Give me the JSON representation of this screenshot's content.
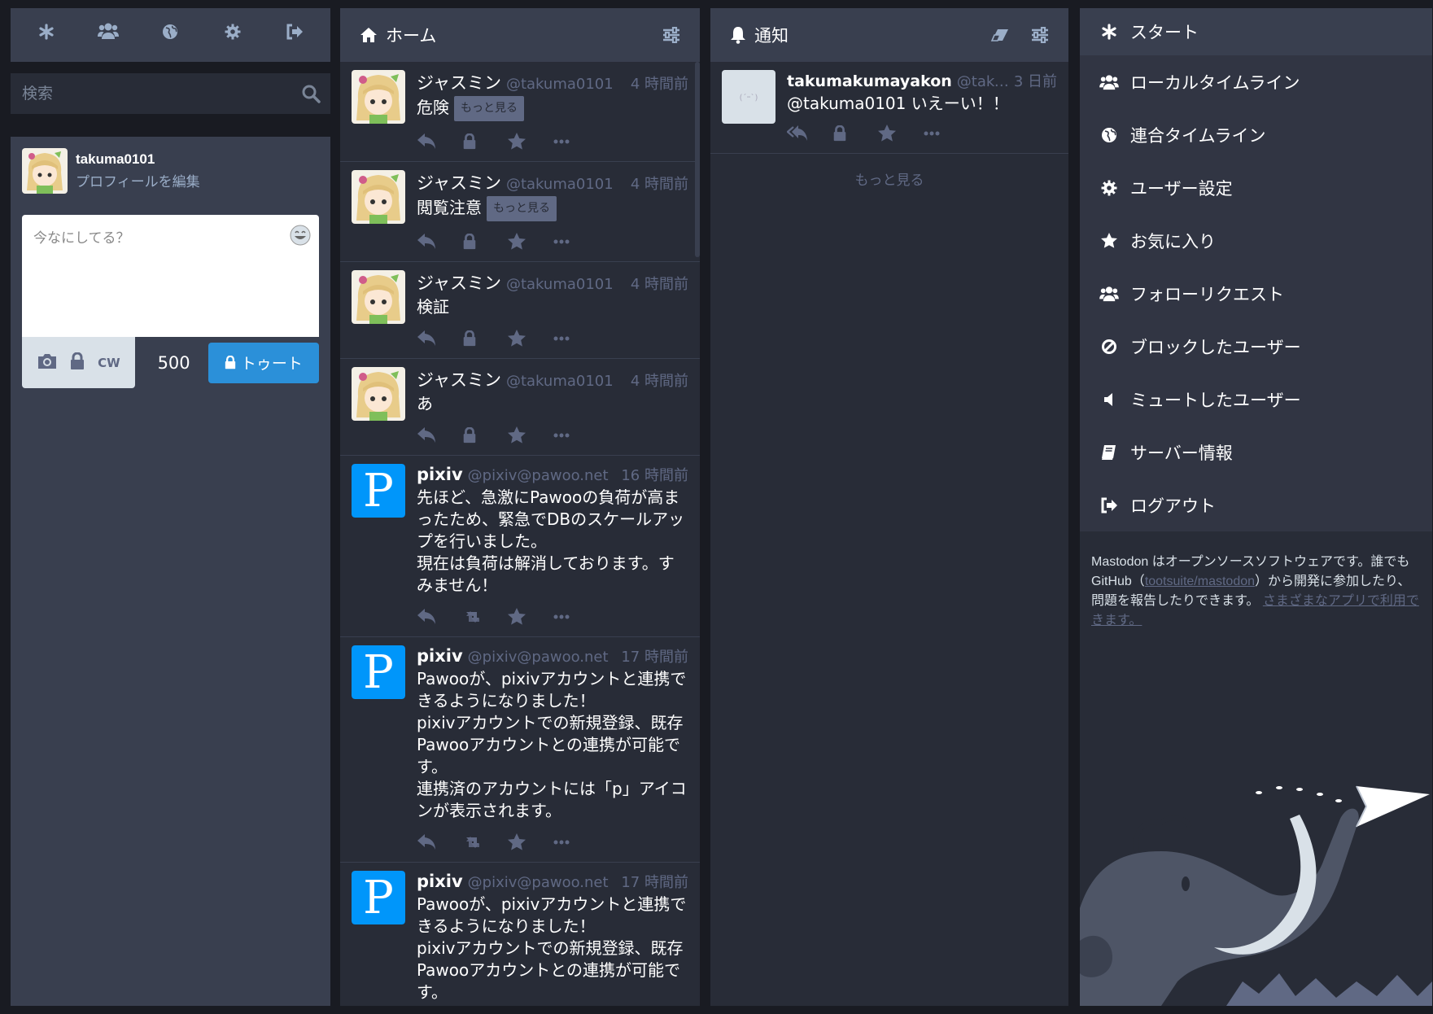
{
  "drawer": {
    "nav": [
      {
        "icon": "asterisk-icon",
        "name": "nav-getting-started"
      },
      {
        "icon": "users-icon",
        "name": "nav-local-timeline"
      },
      {
        "icon": "globe-icon",
        "name": "nav-federated-timeline"
      },
      {
        "icon": "gear-icon",
        "name": "nav-preferences"
      },
      {
        "icon": "sign-out-icon",
        "name": "nav-logout"
      }
    ],
    "search_placeholder": "検索",
    "account": {
      "handle": "takuma0101",
      "edit_profile": "プロフィールを編集"
    },
    "compose": {
      "placeholder": "今なにしてる？",
      "cw_label": "CW",
      "char_count": "500",
      "toot_label": "トゥート"
    }
  },
  "home": {
    "title": "ホーム",
    "statuses": [
      {
        "name": "ジャスミン",
        "acct": "@takuma0101",
        "time": "4 時間前",
        "content": "危険",
        "more": "もっと見る",
        "avatar": "girl",
        "boost": "lock"
      },
      {
        "name": "ジャスミン",
        "acct": "@takuma0101",
        "time": "4 時間前",
        "content": "閲覧注意",
        "more": "もっと見る",
        "avatar": "girl",
        "boost": "lock"
      },
      {
        "name": "ジャスミン",
        "acct": "@takuma0101",
        "time": "4 時間前",
        "content": "検証",
        "more": "",
        "avatar": "girl",
        "boost": "lock"
      },
      {
        "name": "ジャスミン",
        "acct": "@takuma0101",
        "time": "4 時間前",
        "content": "あ",
        "more": "",
        "avatar": "girl",
        "boost": "lock"
      },
      {
        "name": "pixiv",
        "acct": "@pixiv@pawoo.net",
        "time": "16 時間前",
        "content": "先ほど、急激にPawooの負荷が高まったため、緊急でDBのスケールアップを行いました。\n現在は負荷は解消しております。すみません！",
        "more": "",
        "avatar": "pixiv",
        "boost": "retweet"
      },
      {
        "name": "pixiv",
        "acct": "@pixiv@pawoo.net",
        "time": "17 時間前",
        "content": "Pawooが、pixivアカウントと連携できるようになりました！\npixivアカウントでの新規登録、既存Pawooアカウントとの連携が可能です。\n連携済のアカウントには「p」アイコンが表示されます。",
        "more": "",
        "avatar": "pixiv",
        "boost": "retweet"
      },
      {
        "name": "pixiv",
        "acct": "@pixiv@pawoo.net",
        "time": "17 時間前",
        "content": "Pawooが、pixivアカウントと連携できるようになりました！\npixivアカウントでの新規登録、既存Pawooアカウントとの連携が可能です。",
        "more": "",
        "avatar": "pixiv",
        "boost": "retweet"
      }
    ]
  },
  "notifications": {
    "title": "通知",
    "items": [
      {
        "name": "takumakumayakon",
        "acct": "@takum...",
        "time": "3 日前",
        "content": "@takuma0101 いえーい！！"
      }
    ],
    "load_more": "もっと見る"
  },
  "getting_started": {
    "header": "スタート",
    "items": [
      {
        "label": "ローカルタイムライン",
        "icon": "users-icon"
      },
      {
        "label": "連合タイムライン",
        "icon": "globe-icon"
      },
      {
        "label": "ユーザー設定",
        "icon": "gear-icon"
      },
      {
        "label": "お気に入り",
        "icon": "star-icon"
      },
      {
        "label": "フォローリクエスト",
        "icon": "users-icon"
      },
      {
        "label": "ブロックしたユーザー",
        "icon": "ban-icon"
      },
      {
        "label": "ミュートしたユーザー",
        "icon": "volume-off-icon"
      },
      {
        "label": "サーバー情報",
        "icon": "book-icon"
      },
      {
        "label": "ログアウト",
        "icon": "sign-out-icon"
      }
    ],
    "footer": {
      "text1": "Mastodon はオープンソースソフトウェアです。誰でも GitHub（",
      "link1": "tootsuite/mastodon",
      "text2": "）から開発に参加したり、問題を報告したりできます。",
      "link2": "さまざまなアプリで利用できます。"
    }
  },
  "colors": {
    "accent": "#2b90d9",
    "bg": "#191b22",
    "panel": "#282c37",
    "header": "#393f4f",
    "muted": "#606984",
    "light": "#9baec8"
  }
}
